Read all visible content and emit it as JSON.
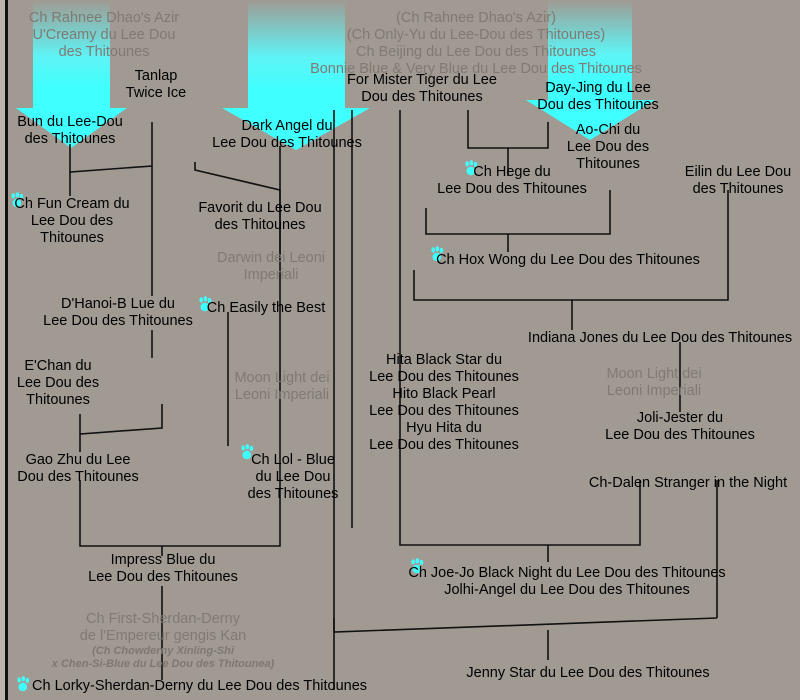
{
  "document": {
    "type": "pedigree-chart",
    "kennel_suffix": "du Lee Dou des Thitounes",
    "background_color": "#A09A92",
    "accent_color": "#4FFFFF",
    "text_color": "#000000",
    "faded_text_color": "#807A73",
    "line_color": "#111111"
  },
  "arrows": [
    {
      "name": "arrow-left",
      "label": "down-arrow-icon"
    },
    {
      "name": "arrow-middle",
      "label": "down-arrow-icon"
    },
    {
      "name": "arrow-right",
      "label": "down-arrow-icon"
    }
  ],
  "nodes": {
    "n01": "Ch Rahnee Dhao's Azir\nU'Creamy du Lee Dou\ndes Thitounes",
    "n02": "(Ch Rahnee Dhao's Azir)\n(Ch Only-Yu du Lee-Dou des Thitounes)\nCh Beijing du Lee Dou des Thitounes\nBonnie Blue & Very Blue du Lee Dou des Thitounes",
    "n03": "Tanlap\nTwice Ice",
    "n04": "For Mister Tiger du Lee\nDou des Thitounes",
    "n05": "Day-Jing du Lee\nDou des Thitounes",
    "n06": "Bun du Lee-Dou\ndes Thitounes",
    "n07": "Dark Angel du\nLee Dou des Thitounes",
    "n08": "Ao-Chi du\nLee Dou des\nThitounes",
    "n09": "Ch Hege du\nLee Dou des Thitounes",
    "n10": "Eilin du Lee Dou\ndes Thitounes",
    "n11": "Ch Fun Cream du\nLee Dou des\nThitounes",
    "n12": "Favorit du Lee Dou\ndes Thitounes",
    "n13": "Darwin dei Leoni\nImperiali",
    "n14": "Ch Hox Wong du Lee Dou des Thitounes",
    "n15": "D'Hanoi-B Lue du\nLee Dou des Thitounes",
    "n16": "Ch Easily the Best",
    "n17": "Indiana Jones du Lee Dou des Thitounes",
    "n18": "E'Chan du\nLee Dou des\nThitounes",
    "n19": "Moon Light dei\nLeoni Imperiali",
    "n20": "Hita Black Star du\nLee Dou des Thitounes\nHito Black Pearl\nLee Dou des Thitounes\nHyu Hita du\nLee Dou des Thitounes",
    "n21": "Moon Light dei\nLeoni Imperiali",
    "n22": "Joli-Jester du\nLee Dou des Thitounes",
    "n23": "Gao Zhu du Lee\nDou des Thitounes",
    "n24": "Ch Lol - Blue\ndu Lee Dou\ndes Thitounes",
    "n25": "Ch-Dalen Stranger in the Night",
    "n26": "Impress Blue du\nLee Dou des Thitounes",
    "n27": "Ch Joe-Jo Black Night du Lee Dou des Thitounes\nJolhi-Angel du Lee Dou des Thitounes",
    "n28": "Ch First-Sherdan-Derny\nde l'Empereur gengis Kan",
    "n29": "(Ch Chowderny Xinling-Shi\nx Chen-Si-Blue du Lee Dou des Thitounea)",
    "n30": "Ch Lorky-Sherdan-Derny du Lee Dou des Thitounes",
    "n31": "Jenny Star du Lee Dou des Thitounes"
  }
}
